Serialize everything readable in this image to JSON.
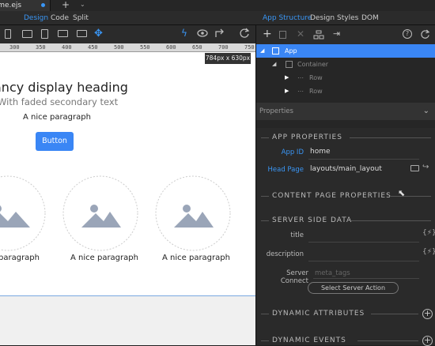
{
  "file_tab": {
    "label": "home.ejs"
  },
  "view_modes": [
    "Design",
    "Code",
    "Split"
  ],
  "right_tabs": [
    "App Structure",
    "Design",
    "Styles",
    "DOM"
  ],
  "ruler_ticks": [
    "300",
    "350",
    "400",
    "450",
    "500",
    "550",
    "600",
    "650",
    "700",
    "750"
  ],
  "canvas_size": "784px x 630px",
  "page": {
    "heading": "ancy display heading",
    "subtext": "With faded secondary text",
    "paragraph": "A nice paragraph",
    "button": "Button",
    "cards": [
      "paragraph",
      "A nice paragraph",
      "A nice paragraph"
    ]
  },
  "tree": {
    "app": "App",
    "container": "Container",
    "row1": "Row",
    "row2": "Row"
  },
  "properties_header": "Properties",
  "app_properties": {
    "title": "APP PROPERTIES",
    "app_id_label": "App ID",
    "app_id_value": "home",
    "head_page_label": "Head Page",
    "head_page_value": "layouts/main_layout"
  },
  "content_page_properties": "CONTENT PAGE PROPERTIES",
  "server_side": {
    "title": "SERVER SIDE DATA",
    "title_label": "title",
    "description_label": "description",
    "server_connect_label": "Server Connect",
    "server_connect_placeholder": "meta_tags",
    "action_button": "Select Server Action"
  },
  "dynamic_attributes": "DYNAMIC ATTRIBUTES",
  "dynamic_events": "DYNAMIC EVENTS"
}
